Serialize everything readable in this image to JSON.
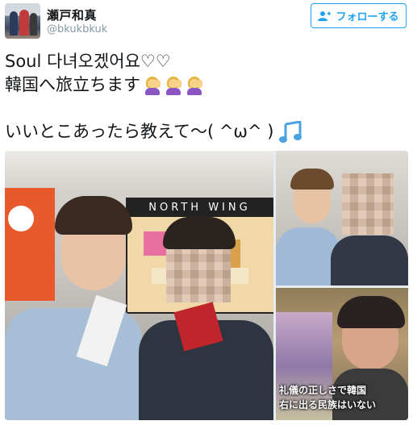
{
  "user": {
    "display_name": "瀬戸和真",
    "handle": "@bkukbkuk"
  },
  "follow_button": {
    "label": "フォローする",
    "icon": "add-user-icon"
  },
  "tweet": {
    "line1": "Soul 다녀오겠어요♡♡",
    "line2": "韓国へ旅立ちます",
    "line3": "いいとこあったら教えて〜( ^ω^ )",
    "emoji_line2": "woman-raising-hand-emoji",
    "emoji_line3": "musical-notes-emoji"
  },
  "media": {
    "sign_text": "NORTH WING",
    "caption_line1": "礼儀の正しさで韓国",
    "caption_line2": "右に出る民族はいない"
  },
  "colors": {
    "accent": "#1da1f2",
    "handle": "#8899a6",
    "text": "#14171a"
  }
}
